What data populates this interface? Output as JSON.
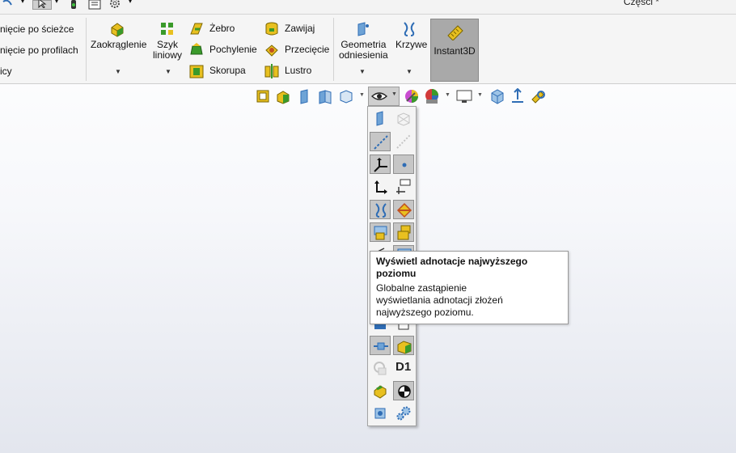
{
  "window": {
    "title": "Części *"
  },
  "ribbon": {
    "partial_items": [
      "nięcie po ścieżce",
      "nięcie po profilach",
      "icy"
    ],
    "zaokraglenie": "Zaokrąglenie",
    "szyk_liniowy": "Szyk\nliniowy",
    "zebro": "Żebro",
    "pochylenie": "Pochylenie",
    "skorupa": "Skorupa",
    "zawijaj": "Zawijaj",
    "przeciecie": "Przecięcie",
    "lustro": "Lustro",
    "geometria": "Geometria\nodniesienia",
    "krzywe": "Krzywe",
    "instant3d": "Instant3D"
  },
  "tooltip": {
    "title": "Wyświetl adnotacje najwyższego\n poziomu",
    "body": "Globalne zastąpienie\n wyświetlania adnotacji złożeń\n najwyższego poziomu."
  },
  "flyout": {
    "d1_label": "D1"
  },
  "colors": {
    "accent_blue": "#2f6db5",
    "icon_yellow": "#e8c020",
    "icon_green": "#3a9a2a",
    "selected_bg": "#c6c6c6"
  }
}
